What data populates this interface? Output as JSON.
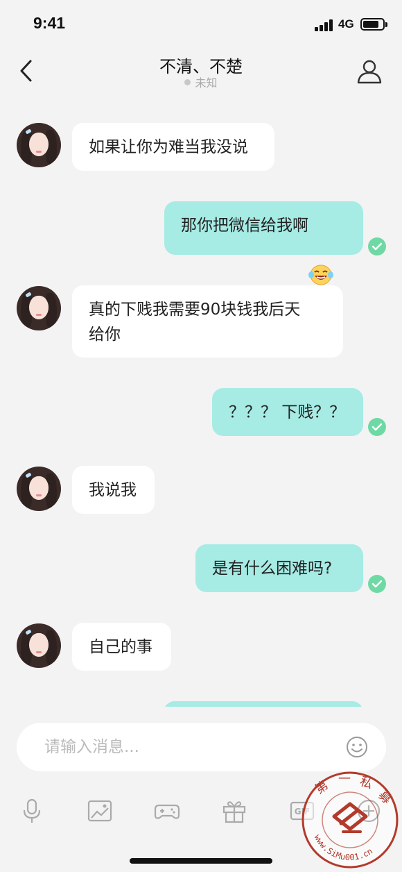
{
  "status_bar": {
    "time": "9:41",
    "network": "4G"
  },
  "header": {
    "title": "不清、不楚",
    "status": "未知"
  },
  "messages": [
    {
      "sender": "them",
      "text": "如果让你为难当我没说"
    },
    {
      "sender": "me",
      "text": "那你把微信给我啊",
      "emoji": "tears-of-joy-emoji",
      "read": true
    },
    {
      "sender": "them",
      "text": "真的下贱我需要90块钱我后天\n给你"
    },
    {
      "sender": "me",
      "text": "？？？ 下贱？？",
      "read": true
    },
    {
      "sender": "them",
      "text": "我说我"
    },
    {
      "sender": "me",
      "text": "是有什么困难吗?",
      "read": true
    },
    {
      "sender": "them",
      "text": "自己的事"
    }
  ],
  "composer": {
    "placeholder": "请输入消息..."
  },
  "toolbar": {
    "items": [
      "microphone-icon",
      "image-icon",
      "gamepad-icon",
      "gift-icon",
      "gif-icon",
      "plus-icon"
    ]
  },
  "watermark": {
    "text": "第一私募",
    "url_text": "www.SiMu001.cn"
  },
  "colors": {
    "background": "#f3f3f3",
    "incoming_bubble": "#ffffff",
    "outgoing_bubble": "#a6ebe4",
    "read_receipt": "#6fd9a5"
  }
}
